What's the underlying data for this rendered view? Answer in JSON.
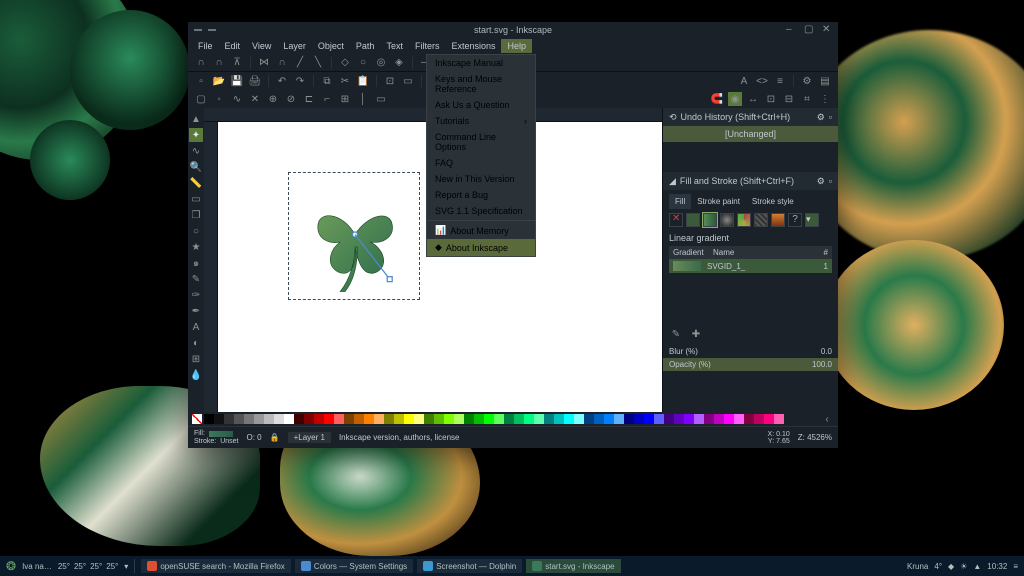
{
  "window": {
    "title": "start.svg - Inkscape"
  },
  "menubar": [
    "File",
    "Edit",
    "View",
    "Layer",
    "Object",
    "Path",
    "Text",
    "Filters",
    "Extensions",
    "Help"
  ],
  "active_menu": "Help",
  "help_menu": {
    "items": [
      "Inkscape Manual",
      "Keys and Mouse Reference",
      "Ask Us a Question",
      "Tutorials",
      "Command Line Options",
      "FAQ",
      "New in This Version",
      "Report a Bug",
      "SVG 1.1 Specification"
    ],
    "separator_after": 8,
    "footer_items": [
      "About Memory",
      "About Inkscape"
    ],
    "highlighted": "About Inkscape",
    "submenu_item": "Tutorials"
  },
  "panels": {
    "undo": {
      "title": "Undo History (Shift+Ctrl+H)",
      "state": "[Unchanged]"
    },
    "fillstroke": {
      "title": "Fill and Stroke (Shift+Ctrl+F)",
      "tabs": [
        "Fill",
        "Stroke paint",
        "Stroke style"
      ],
      "active_tab": "Fill",
      "section": "Linear gradient",
      "cols": {
        "c1": "Gradient",
        "c2": "Name",
        "c3": "#"
      },
      "row": {
        "name": "SVGID_1_",
        "count": "1"
      },
      "blur_label": "Blur (%)",
      "blur_val": "0.0",
      "opacity_label": "Opacity (%)",
      "opacity_val": "100.0"
    }
  },
  "status": {
    "fill_label": "Fill:",
    "stroke_label": "Stroke:",
    "stroke_val": "Unset",
    "opacity_label": "O:",
    "opacity_val": "0",
    "lock": "🔒",
    "layer": "+Layer 1",
    "message": "Inkscape version, authors, license",
    "x_label": "X:",
    "x_val": "0.10",
    "y_label": "Y:",
    "y_val": "7.65",
    "zoom_label": "Z:",
    "zoom": "4526%"
  },
  "palette_colors": [
    "#000",
    "#111",
    "#333",
    "#555",
    "#777",
    "#999",
    "#bbb",
    "#ddd",
    "#fff",
    "#400000",
    "#800000",
    "#c00000",
    "#ff0000",
    "#ff6060",
    "#804000",
    "#c06000",
    "#ff8000",
    "#ffb060",
    "#808000",
    "#c0c000",
    "#ffff00",
    "#ffff80",
    "#408000",
    "#60c000",
    "#80ff00",
    "#b0ff60",
    "#008000",
    "#00c000",
    "#00ff00",
    "#60ff60",
    "#008040",
    "#00c060",
    "#00ff80",
    "#60ffb0",
    "#008080",
    "#00c0c0",
    "#00ffff",
    "#80ffff",
    "#004080",
    "#0060c0",
    "#0080ff",
    "#60b0ff",
    "#000080",
    "#0000c0",
    "#0000ff",
    "#6060ff",
    "#400080",
    "#6000c0",
    "#8000ff",
    "#b060ff",
    "#800080",
    "#c000c0",
    "#ff00ff",
    "#ff60ff",
    "#800040",
    "#c00060",
    "#ff0080",
    "#ff60b0"
  ],
  "taskbar": {
    "user": "Iva  na…",
    "temps": [
      "25°",
      "25°",
      "25°",
      "25°"
    ],
    "tasks": [
      {
        "label": "openSUSE search - Mozilla Firefox",
        "icon_color": "#e05030"
      },
      {
        "label": "Colors — System Settings",
        "icon_color": "#4a8ad0"
      },
      {
        "label": "Screenshot — Dolphin",
        "icon_color": "#3a9ad0"
      },
      {
        "label": "start.svg - Inkscape",
        "icon_color": "#3a7a5a",
        "active": true
      }
    ],
    "right": {
      "place": "Kruna",
      "temp": "4°",
      "icon": "☀",
      "clock": "10:32"
    }
  }
}
